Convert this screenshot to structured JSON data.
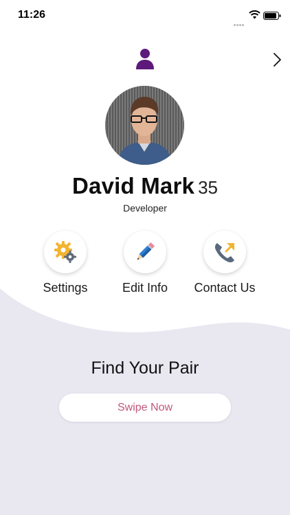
{
  "status_bar": {
    "time": "11:26"
  },
  "profile": {
    "name": "David Mark",
    "age": "35",
    "title": "Developer"
  },
  "actions": [
    {
      "label": "Settings",
      "icon": "gear-icon"
    },
    {
      "label": "Edit Info",
      "icon": "pencil-icon"
    },
    {
      "label": "Contact Us",
      "icon": "phone-icon"
    }
  ],
  "find": {
    "title": "Find Your Pair",
    "button_label": "Swipe Now"
  },
  "colors": {
    "accent_purple": "#5e1a7a",
    "button_text": "#c0587b",
    "lower_background": "#e9e7f0"
  }
}
